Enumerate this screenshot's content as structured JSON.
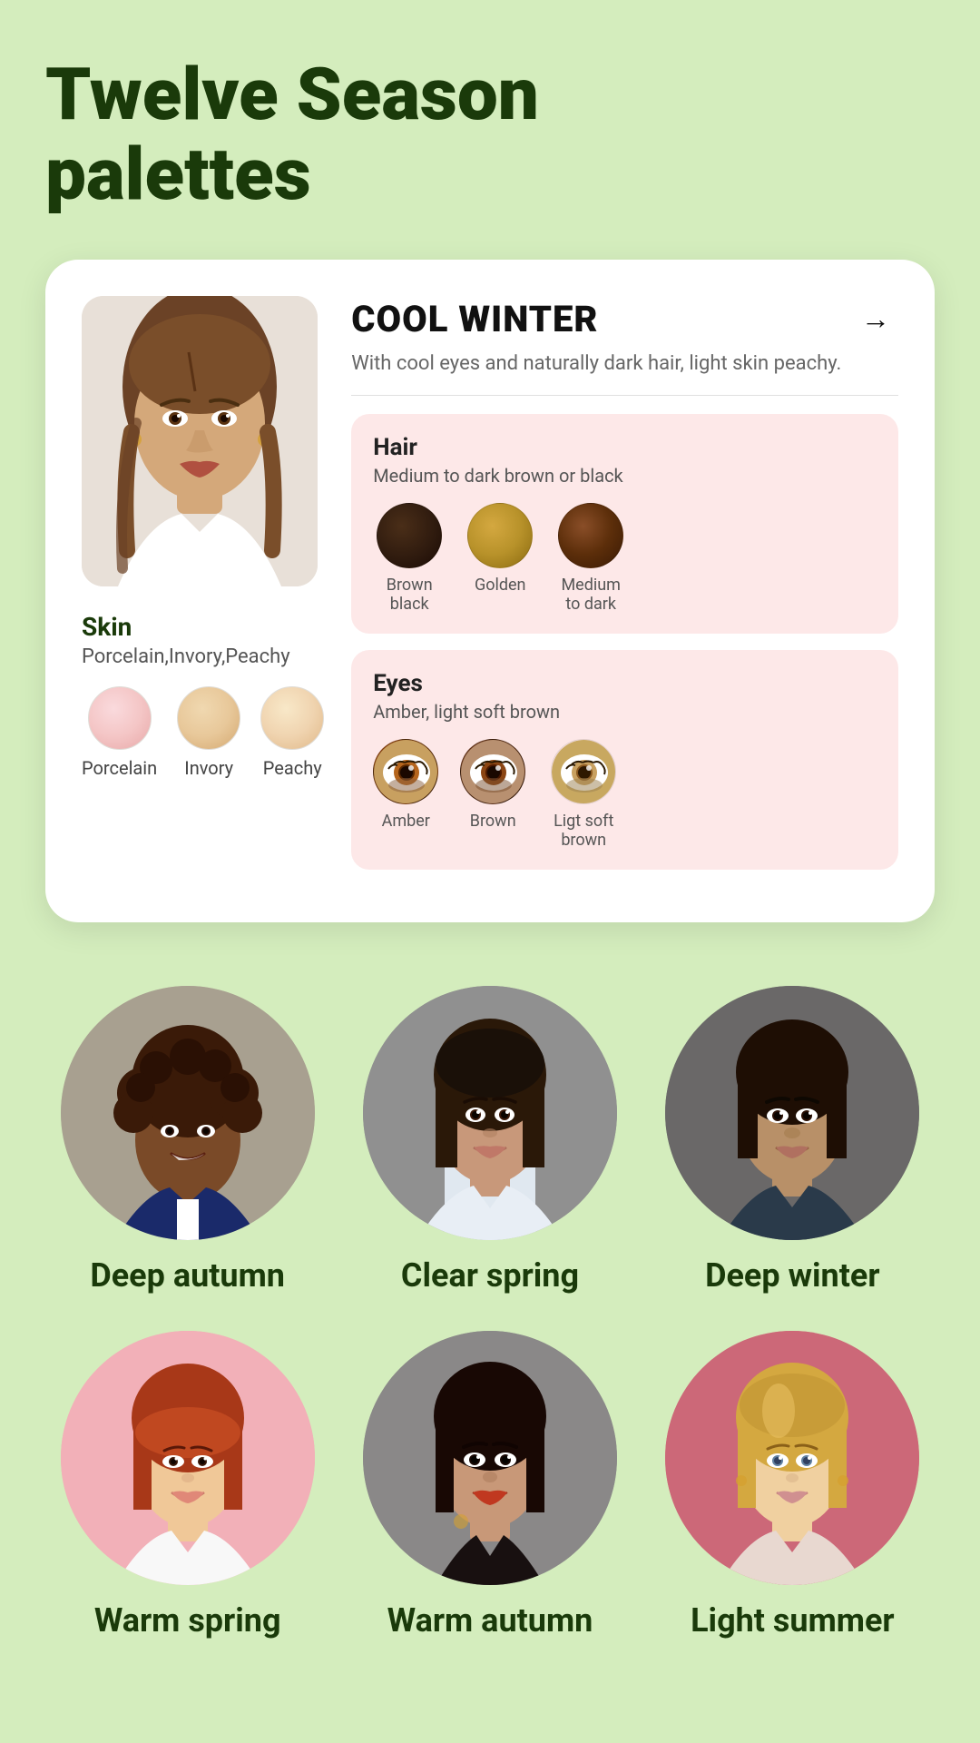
{
  "page": {
    "title_line1": "Twelve Season",
    "title_line2": "palettes",
    "background_color": "#d4edbd"
  },
  "card": {
    "season_name": "COOL WINTER",
    "season_description": "With cool eyes and naturally dark hair, light skin peachy.",
    "arrow_label": "→",
    "skin": {
      "label": "Skin",
      "sublabel": "Porcelain,Invory,Peachy",
      "swatches": [
        {
          "name": "Porcelain",
          "color": "#f4c6c6"
        },
        {
          "name": "Invory",
          "color": "#e8c89a"
        },
        {
          "name": "Peachy",
          "color": "#f0d4b0"
        }
      ]
    },
    "hair": {
      "label": "Hair",
      "sublabel": "Medium to dark brown or black",
      "swatches": [
        {
          "name": "Brown black",
          "color": "#2e1a0e"
        },
        {
          "name": "Golden",
          "color": "#b8922a"
        },
        {
          "name": "Medium to dark",
          "color": "#5c2e0a"
        }
      ]
    },
    "eyes": {
      "label": "Eyes",
      "sublabel": "Amber, light soft brown",
      "swatches": [
        {
          "name": "Amber",
          "type": "eye-amber"
        },
        {
          "name": "Brown",
          "type": "eye-brown"
        },
        {
          "name": "Ligt soft brown",
          "type": "eye-light-soft-brown"
        }
      ]
    }
  },
  "season_grid": {
    "row1": [
      {
        "name": "Deep autumn",
        "bg": "avatar-bg-light",
        "skin_tone": "#c8a87a"
      },
      {
        "name": "Clear spring",
        "bg": "avatar-bg-gray",
        "skin_tone": "#c8a070"
      },
      {
        "name": "Deep winter",
        "bg": "avatar-bg-darkgray",
        "skin_tone": "#b8906a"
      }
    ],
    "row2": [
      {
        "name": "Warm spring",
        "bg": "avatar-bg-pink",
        "skin_tone": "#f0c898"
      },
      {
        "name": "Warm autumn",
        "bg": "avatar-bg-gray",
        "skin_tone": "#c89878"
      },
      {
        "name": "Light summer",
        "bg": "avatar-bg-rose",
        "skin_tone": "#e8c8a0"
      }
    ]
  }
}
